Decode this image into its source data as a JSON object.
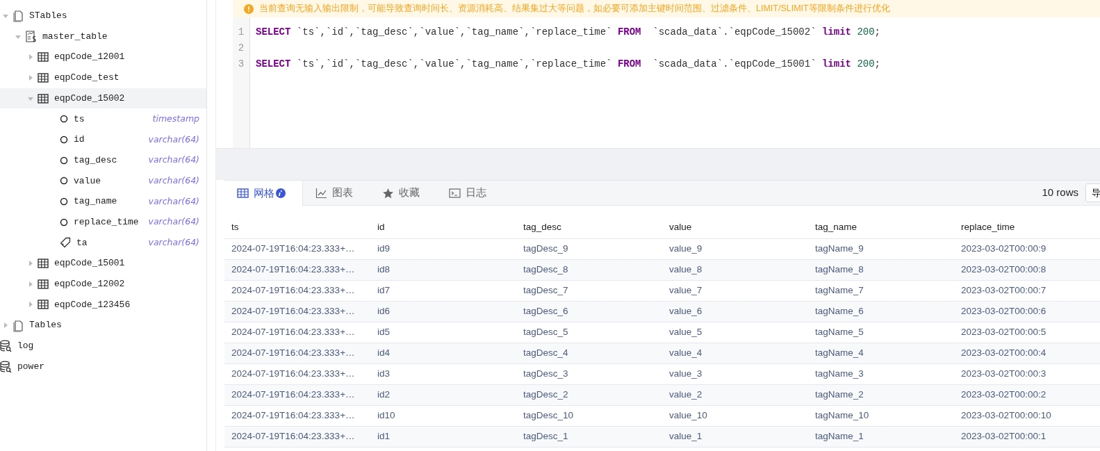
{
  "sidebar": {
    "tree": [
      {
        "kind": "group",
        "label": "STables",
        "expanded": true,
        "selected": false,
        "children": [
          {
            "kind": "stable",
            "label": "master_table",
            "expanded": true,
            "selected": false,
            "children": [
              {
                "kind": "table",
                "label": "eqpCode_12001",
                "expanded": false,
                "selected": false
              },
              {
                "kind": "table",
                "label": "eqpCode_test",
                "expanded": false,
                "selected": false
              },
              {
                "kind": "table",
                "label": "eqpCode_15002",
                "expanded": true,
                "selected": true,
                "children": [
                  {
                    "kind": "column",
                    "label": "ts",
                    "type": "timestamp"
                  },
                  {
                    "kind": "column",
                    "label": "id",
                    "type": "varchar(64)"
                  },
                  {
                    "kind": "column",
                    "label": "tag_desc",
                    "type": "varchar(64)"
                  },
                  {
                    "kind": "column",
                    "label": "value",
                    "type": "varchar(64)"
                  },
                  {
                    "kind": "column",
                    "label": "tag_name",
                    "type": "varchar(64)"
                  },
                  {
                    "kind": "column",
                    "label": "replace_time",
                    "type": "varchar(64)"
                  },
                  {
                    "kind": "tag",
                    "label": "ta",
                    "type": "varchar(64)"
                  }
                ]
              },
              {
                "kind": "table",
                "label": "eqpCode_15001",
                "expanded": false,
                "selected": false
              },
              {
                "kind": "table",
                "label": "eqpCode_12002",
                "expanded": false,
                "selected": false
              },
              {
                "kind": "table",
                "label": "eqpCode_123456",
                "expanded": false,
                "selected": false
              }
            ]
          }
        ]
      },
      {
        "kind": "group",
        "label": "Tables",
        "expanded": false,
        "selected": false
      },
      {
        "kind": "database",
        "label": "log"
      },
      {
        "kind": "database",
        "label": "power"
      }
    ]
  },
  "warning": {
    "text": "当前查询无输入输出限制，可能导致查询时间长、资源消耗高、结果集过大等问题，如必要可添加主键时间范围、过滤条件、LIMIT/SLIMIT等限制条件进行优化"
  },
  "editor": {
    "lines": [
      {
        "number": "1",
        "tokens": [
          {
            "kind": "keyword",
            "text": "SELECT"
          },
          {
            "kind": "plain",
            "text": " `ts`,`id`,`tag_desc`,`value`,`tag_name`,`replace_time` "
          },
          {
            "kind": "keyword",
            "text": "FROM"
          },
          {
            "kind": "plain",
            "text": "  `scada_data`.`eqpCode_15002` "
          },
          {
            "kind": "keyword",
            "text": "limit"
          },
          {
            "kind": "number",
            "text": "200"
          },
          {
            "kind": "plain",
            "text": ";"
          }
        ]
      },
      {
        "number": "2"
      },
      {
        "number": "3",
        "tokens": [
          {
            "kind": "keyword",
            "text": "SELECT"
          },
          {
            "kind": "plain",
            "text": " `ts`,`id`,`tag_desc`,`value`,`tag_name`,`replace_time` "
          },
          {
            "kind": "keyword",
            "text": "FROM"
          },
          {
            "kind": "plain",
            "text": "  `scada_data`.`eqpCode_15001` "
          },
          {
            "kind": "keyword",
            "text": "limit"
          },
          {
            "kind": "number",
            "text": "200"
          },
          {
            "kind": "plain",
            "text": ";"
          }
        ]
      }
    ]
  },
  "results": {
    "tabs": [
      {
        "kind": "grid",
        "label": "网格",
        "selected": true
      },
      {
        "kind": "chart",
        "label": "图表",
        "selected": false
      },
      {
        "kind": "star",
        "label": "收藏",
        "selected": false
      },
      {
        "kind": "terminal",
        "label": "日志",
        "selected": false
      }
    ],
    "row_count": "10 rows",
    "export_button": "导",
    "table": {
      "columns": [
        "ts",
        "id",
        "tag_desc",
        "value",
        "tag_name",
        "replace_time"
      ],
      "rows": [
        [
          "2024-07-19T16:04:23.333+…",
          "id9",
          "tagDesc_9",
          "value_9",
          "tagName_9",
          "2023-03-02T00:00:9"
        ],
        [
          "2024-07-19T16:04:23.333+…",
          "id8",
          "tagDesc_8",
          "value_8",
          "tagName_8",
          "2023-03-02T00:00:8"
        ],
        [
          "2024-07-19T16:04:23.333+…",
          "id7",
          "tagDesc_7",
          "value_7",
          "tagName_7",
          "2023-03-02T00:00:7"
        ],
        [
          "2024-07-19T16:04:23.333+…",
          "id6",
          "tagDesc_6",
          "value_6",
          "tagName_6",
          "2023-03-02T00:00:6"
        ],
        [
          "2024-07-19T16:04:23.333+…",
          "id5",
          "tagDesc_5",
          "value_5",
          "tagName_5",
          "2023-03-02T00:00:5"
        ],
        [
          "2024-07-19T16:04:23.333+…",
          "id4",
          "tagDesc_4",
          "value_4",
          "tagName_4",
          "2023-03-02T00:00:4"
        ],
        [
          "2024-07-19T16:04:23.333+…",
          "id3",
          "tagDesc_3",
          "value_3",
          "tagName_3",
          "2023-03-02T00:00:3"
        ],
        [
          "2024-07-19T16:04:23.333+…",
          "id2",
          "tagDesc_2",
          "value_2",
          "tagName_2",
          "2023-03-02T00:00:2"
        ],
        [
          "2024-07-19T16:04:23.333+…",
          "id10",
          "tagDesc_10",
          "value_10",
          "tagName_10",
          "2023-03-02T00:00:10"
        ],
        [
          "2024-07-19T16:04:23.333+…",
          "id1",
          "tagDesc_1",
          "value_1",
          "tagName_1",
          "2023-03-02T00:00:1"
        ]
      ]
    }
  }
}
